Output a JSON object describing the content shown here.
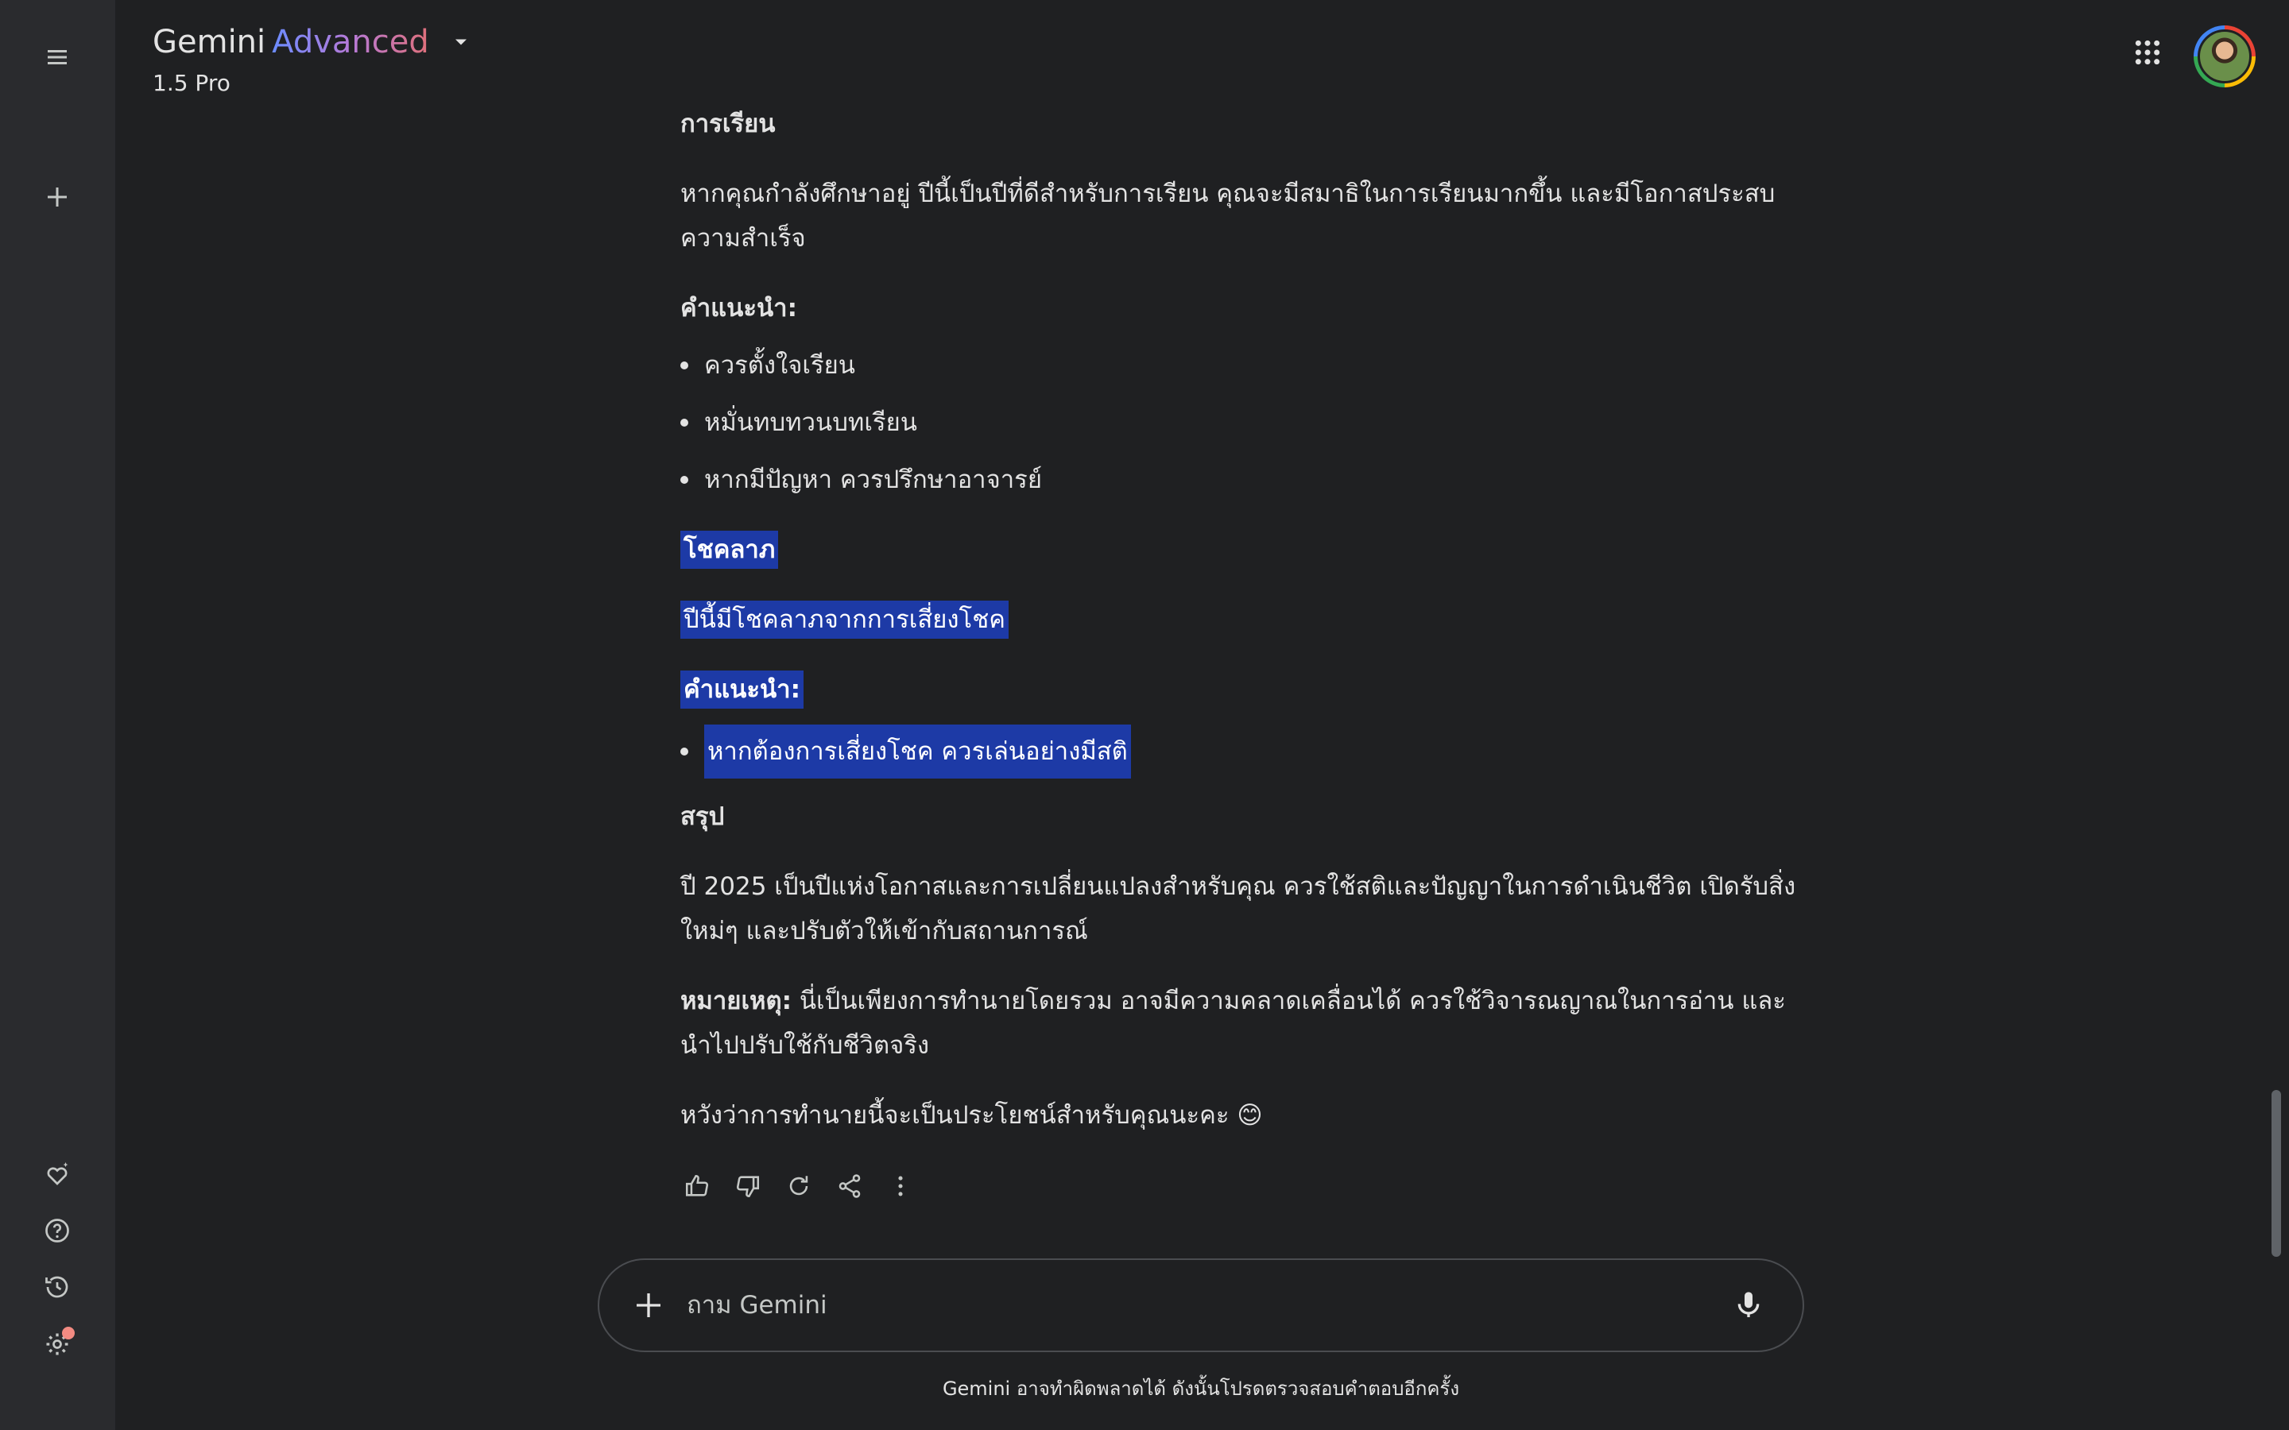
{
  "header": {
    "brand_name": "Gemini",
    "brand_tier": "Advanced",
    "model": "1.5 Pro"
  },
  "sidebar": {
    "icons": [
      "menu-icon",
      "new-chat-icon",
      "gem-manager-icon",
      "help-icon",
      "activity-icon",
      "settings-icon"
    ]
  },
  "response": {
    "study_heading": "การเรียน",
    "study_text": "หากคุณกำลังศึกษาอยู่  ปีนี้เป็นปีที่ดีสำหรับการเรียน  คุณจะมีสมาธิในการเรียนมากขึ้น  และมีโอกาสประสบความสำเร็จ",
    "study_advice_heading": "คำแนะนำ:",
    "study_advice": [
      "ควรตั้งใจเรียน",
      "หมั่นทบทวนบทเรียน",
      "หากมีปัญหา ควรปรึกษาอาจารย์"
    ],
    "luck_heading": "โชคลาภ",
    "luck_text": "ปีนี้มีโชคลาภจากการเสี่ยงโชค",
    "luck_advice_heading": "คำแนะนำ:",
    "luck_advice": [
      "หากต้องการเสี่ยงโชค ควรเล่นอย่างมีสติ"
    ],
    "summary_heading": "สรุป",
    "summary_text": "ปี 2025 เป็นปีแห่งโอกาสและการเปลี่ยนแปลงสำหรับคุณ  ควรใช้สติและปัญญาในการดำเนินชีวิต  เปิดรับสิ่งใหม่ๆ และปรับตัวให้เข้ากับสถานการณ์",
    "note_label": "หมายเหตุ:",
    "note_text": " นี่เป็นเพียงการทำนายโดยรวม  อาจมีความคลาดเคลื่อนได้  ควรใช้วิจารณญาณในการอ่าน  และนำไปปรับใช้กับชีวิตจริง",
    "closing_text": "หวังว่าการทำนายนี้จะเป็นประโยชน์สำหรับคุณนะคะ  😊"
  },
  "actions": [
    "thumbs-up-icon",
    "thumbs-down-icon",
    "regenerate-icon",
    "share-icon",
    "more-options-icon"
  ],
  "input": {
    "placeholder": "ถาม Gemini"
  },
  "footer": {
    "disclaimer": "Gemini อาจทำผิดพลาดได้ ดังนั้นโปรดตรวจสอบคำตอบอีกครั้ง"
  },
  "colors": {
    "background": "#1f2022",
    "sidebar": "#2a2b2e",
    "selection": "#1d3aa6",
    "notification_dot": "#f28b82"
  }
}
